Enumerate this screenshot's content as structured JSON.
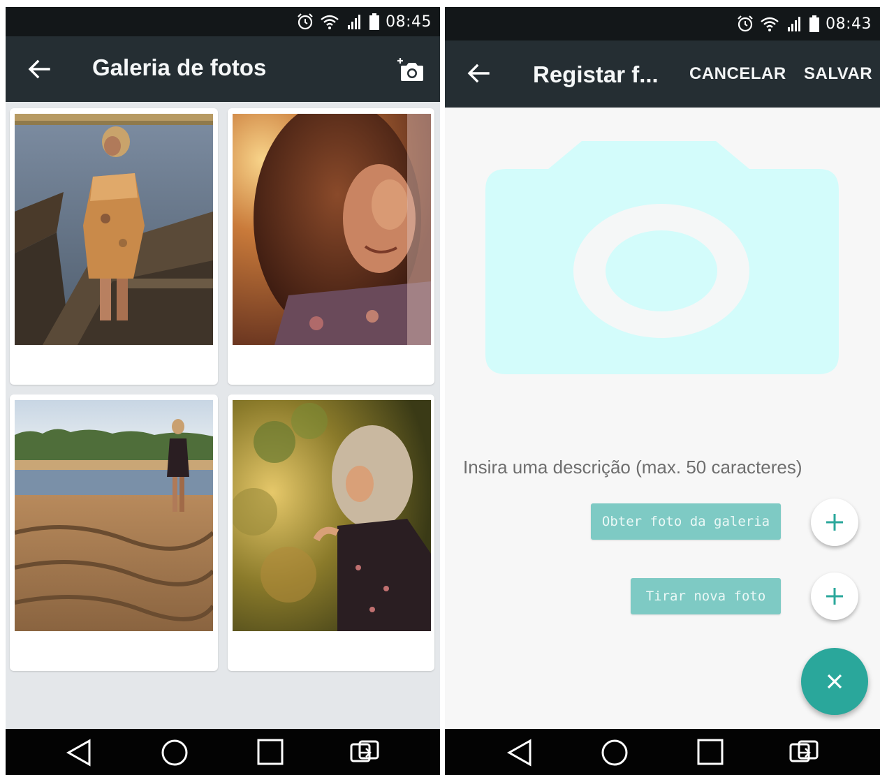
{
  "gallery_screen": {
    "status": {
      "time": "08:45"
    },
    "appbar": {
      "title": "Galeria de fotos"
    },
    "photos": [
      {
        "subject": "woman-on-boat-photo"
      },
      {
        "subject": "woman-sunset-portrait-photo"
      },
      {
        "subject": "woman-on-beach-photo"
      },
      {
        "subject": "woman-in-field-photo"
      }
    ]
  },
  "register_screen": {
    "status": {
      "time": "08:43"
    },
    "appbar": {
      "title": "Registar f...",
      "cancel_label": "CANCELAR",
      "save_label": "SALVAR"
    },
    "description_placeholder": "Insira uma descrição (max. 50 caracteres)",
    "gallery_button_label": "Obter foto da galeria",
    "camera_button_label": "Tirar nova foto"
  },
  "colors": {
    "appbar": "#252e33",
    "statusbar": "#131719",
    "accent": "#2aa79b",
    "chip": "#7ecac4",
    "placeholder": "#d3fcfb"
  },
  "icons": [
    "back-arrow-icon",
    "add-camera-icon",
    "plus-icon",
    "close-icon",
    "alarm-icon",
    "wifi-icon",
    "signal-icon",
    "battery-icon",
    "nav-back-icon",
    "nav-home-icon",
    "nav-recents-icon",
    "nav-switch-icon"
  ]
}
